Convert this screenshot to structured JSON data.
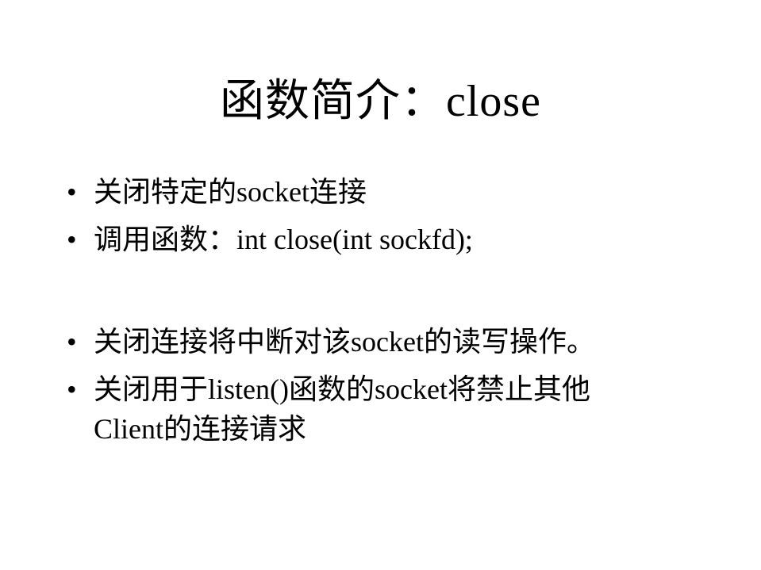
{
  "slide": {
    "title": "函数简介：close",
    "bullet_symbol": "•",
    "bullets": [
      {
        "text": "关闭特定的socket连接"
      },
      {
        "text": "调用函数：int close(int sockfd);"
      },
      {
        "text": "关闭连接将中断对该socket的读写操作。"
      },
      {
        "lines": [
          "关闭用于listen()函数的socket将禁止其他",
          "Client的连接请求"
        ]
      }
    ]
  },
  "colors": {
    "background": "#ffffff",
    "text": "#000000"
  }
}
